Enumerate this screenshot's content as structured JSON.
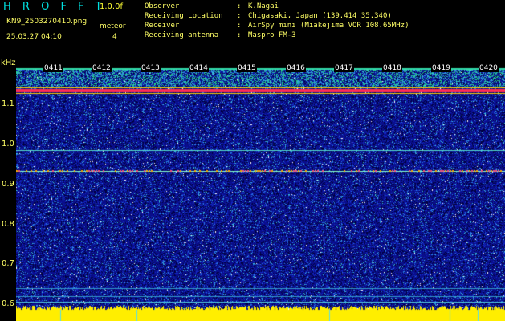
{
  "header": {
    "app_title": "H R O F F T",
    "version": "1.0.0f",
    "filename": "KN9_2503270410.png",
    "meteor_label": "meteor",
    "meteor_count": "4",
    "datetime": "25.03.27 04:10",
    "info": [
      {
        "key": "Observer",
        "value": "K.Nagai"
      },
      {
        "key": "Receiving Location",
        "value": "Chigasaki, Japan (139.414 35.340)"
      },
      {
        "key": "Receiver",
        "value": "AirSpy mini (Miakejima VOR 108.65MHz)"
      },
      {
        "key": "Receiving antenna",
        "value": "Maspro FM-3"
      }
    ]
  },
  "axis": {
    "y_unit": "kHz",
    "y_ticks": [
      "1.1",
      "1.0",
      "0.9",
      "0.8",
      "0.7",
      "0.6"
    ],
    "time_labels": [
      "0411",
      "0412",
      "0413",
      "0414",
      "0415",
      "0416",
      "0417",
      "0418",
      "0419",
      "0420"
    ]
  },
  "colors": {
    "background": "#000000",
    "label_yellow": "#ffff66",
    "title_cyan": "#00e0e0",
    "noise_deep": "#0a0e8c",
    "carrier_red": "#ff2a55",
    "floor_yellow": "#ffee00",
    "line_cyan": "#55ddcc"
  }
}
